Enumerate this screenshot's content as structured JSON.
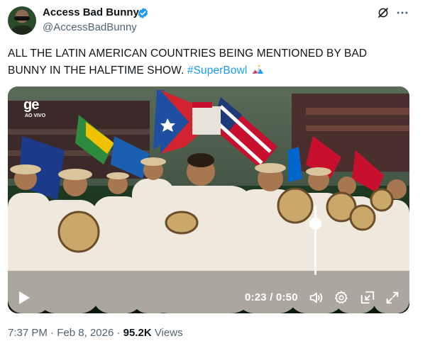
{
  "author": {
    "display_name": "Access Bad Bunny",
    "handle": "@AccessBadBunny",
    "verified": true
  },
  "tweet": {
    "text": "ALL THE LATIN AMERICAN COUNTRIES BEING MENTIONED BY BAD BUNNY IN THE HALFTIME SHOW. ",
    "hashtag": "#SuperBowl"
  },
  "video": {
    "channel_logo": "ge",
    "channel_sub": "AO VIVO",
    "time": "0:23 / 0:50",
    "volume_level": 0.75,
    "controls": [
      "play-icon",
      "volume-icon",
      "settings-gear-icon",
      "pip-icon",
      "fullscreen-icon"
    ]
  },
  "meta": {
    "time": "7:37 PM",
    "separator": "·",
    "date": "Feb 8, 2026",
    "views_count": "95.2K",
    "views_label": "Views"
  },
  "colors": {
    "link": "#1d9bf0",
    "text": "#0f1419",
    "secondary": "#536471"
  }
}
